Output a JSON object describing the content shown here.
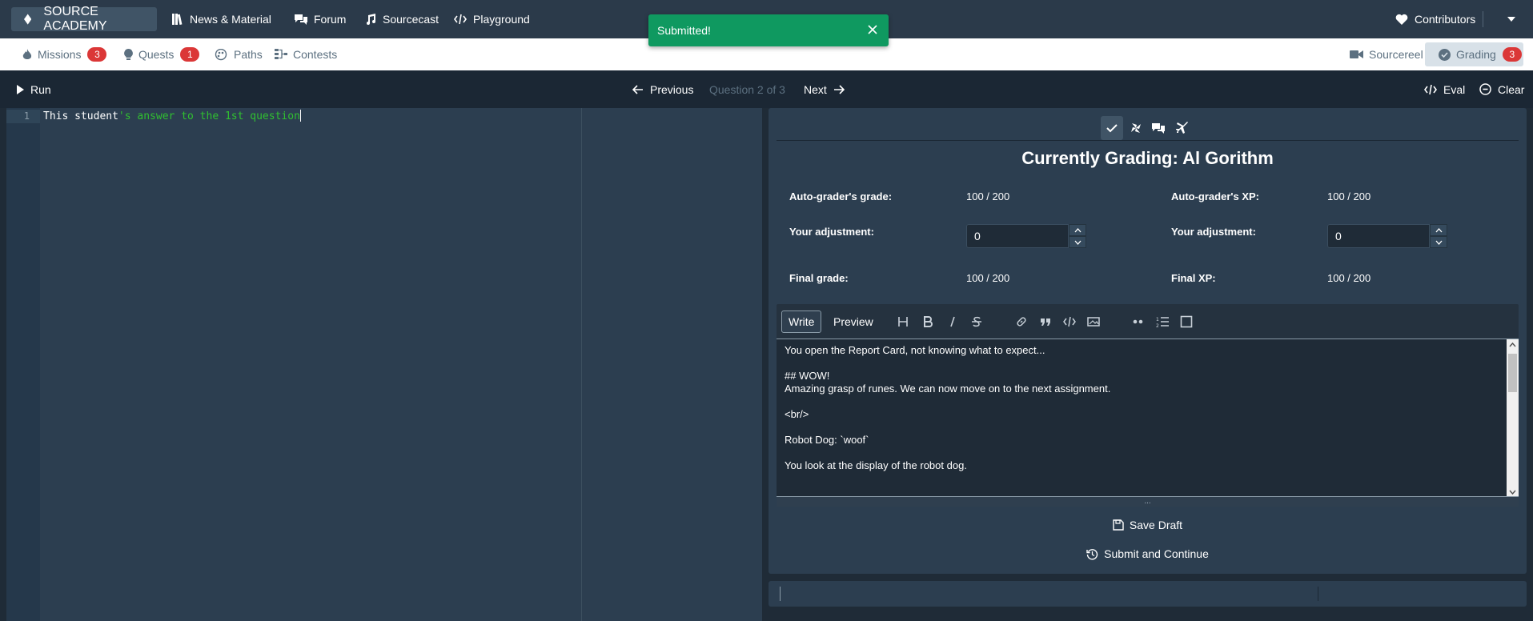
{
  "topnav": {
    "brand": "SOURCE ACADEMY",
    "items": [
      {
        "label": "News & Material",
        "icon": "book-icon"
      },
      {
        "label": "Forum",
        "icon": "chat-icon"
      },
      {
        "label": "Sourcecast",
        "icon": "music-icon"
      },
      {
        "label": "Playground",
        "icon": "code-icon"
      }
    ],
    "contributors": "Contributors"
  },
  "subnav": {
    "missions": {
      "label": "Missions",
      "count": "3"
    },
    "quests": {
      "label": "Quests",
      "count": "1"
    },
    "paths": {
      "label": "Paths"
    },
    "contests": {
      "label": "Contests"
    },
    "sourcereel": {
      "label": "Sourcereel"
    },
    "grading": {
      "label": "Grading",
      "count": "3"
    }
  },
  "controlbar": {
    "run": "Run",
    "previous": "Previous",
    "question": "Question 2 of 3",
    "next": "Next",
    "eval": "Eval",
    "clear": "Clear"
  },
  "editor": {
    "line_number": "1",
    "code_id": "This student",
    "code_str": "'s answer to the 1st question"
  },
  "grading": {
    "title": "Currently Grading: Al Gorithm",
    "autograder_grade_label": "Auto-grader's grade:",
    "autograder_grade_value": "100 / 200",
    "autograder_xp_label": "Auto-grader's XP:",
    "autograder_xp_value": "100 / 200",
    "adjust_grade_label": "Your adjustment:",
    "adjust_grade_value": "0",
    "adjust_xp_label": "Your adjustment:",
    "adjust_xp_value": "0",
    "final_grade_label": "Final grade:",
    "final_grade_value": "100 / 200",
    "final_xp_label": "Final XP:",
    "final_xp_value": "100 / 200"
  },
  "editor_md": {
    "write_tab": "Write",
    "preview_tab": "Preview",
    "lines": [
      "You open the Report Card, not knowing what to expect...",
      "## WOW!",
      "Amazing grasp of runes. We can now move on to the next assignment.",
      "<br/>",
      "Robot Dog: `woof`",
      "You look at the display of the robot dog."
    ],
    "grip": "..."
  },
  "actions": {
    "save_draft": "Save Draft",
    "submit_continue": "Submit and Continue"
  },
  "toast": {
    "message": "Submitted!",
    "color": "#0f9960"
  },
  "colors": {
    "topbar": "#2b3a4a",
    "panel": "#2c3e50",
    "badge": "#db3737"
  }
}
